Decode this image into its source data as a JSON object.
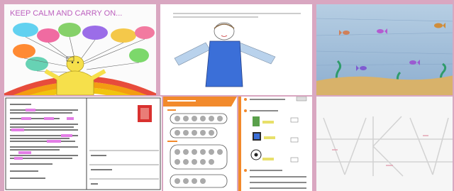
{
  "gallery": {
    "tiles": [
      {
        "alt": "Children's drawing: yellow figure with colorful speech bubbles above a rainbow",
        "heading": "KEEP CALM AND CARRY ON..."
      },
      {
        "alt": "Drawing of a stick figure in a blue dress with outstretched arms"
      },
      {
        "alt": "Painted underwater scene with fish, seaweed and sand"
      },
      {
        "alt": "Worksheet letter with highlighted words and a red stamp"
      },
      {
        "alt": "Orange worksheet with circled counting exercises"
      },
      {
        "alt": "Worksheet listing items with images and check boxes"
      },
      {
        "alt": "Faint pencil drawing on white paper"
      }
    ]
  },
  "colors": {
    "frame_pink": "#d9a7c1",
    "rainbow_red": "#e74c3c",
    "dress_blue": "#3b6fd8",
    "sea_blue": "#9bb7d3",
    "sand": "#d8b26a",
    "worksheet_orange": "#f28a2c",
    "highlight_magenta": "#e37de6",
    "stamp_red": "#d9312f"
  }
}
